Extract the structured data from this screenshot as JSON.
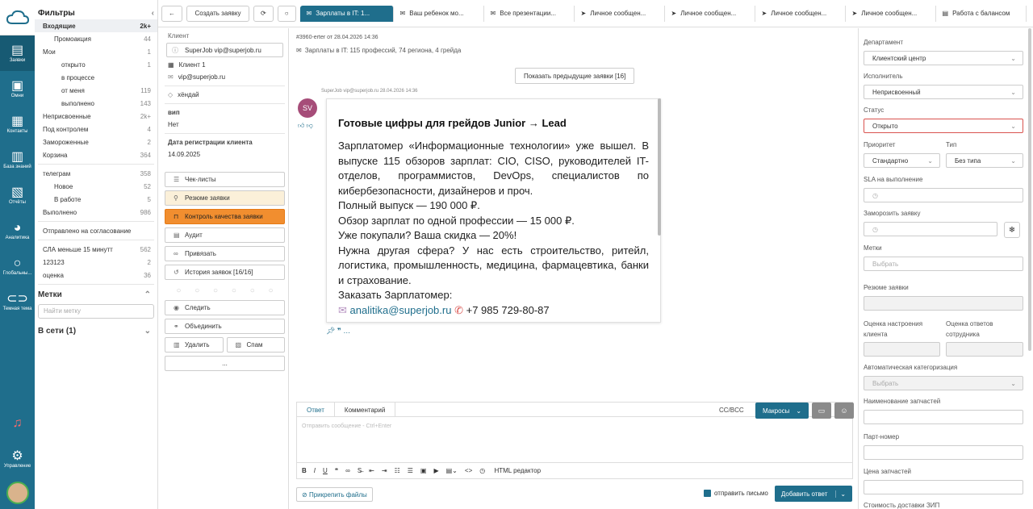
{
  "nav": {
    "items": [
      {
        "label": "Заявки",
        "icon": "tickets-icon"
      },
      {
        "label": "Омни",
        "icon": "omni-icon"
      },
      {
        "label": "Контакты",
        "icon": "contacts-icon"
      },
      {
        "label": "База знаний",
        "icon": "knowledge-icon"
      },
      {
        "label": "Отчёты",
        "icon": "reports-icon"
      },
      {
        "label": "Аналитика",
        "icon": "analytics-icon"
      },
      {
        "label": "Глобальны...",
        "icon": "search-icon"
      },
      {
        "label": "Темная тема",
        "icon": "toggle-icon"
      }
    ],
    "manage_label": "Управление"
  },
  "filters": {
    "title": "Фильтры",
    "rows": [
      {
        "label": "Входящие",
        "count": "2k+"
      },
      {
        "label": "Промоакция",
        "count": "44"
      },
      {
        "label": "Мои",
        "count": "1"
      },
      {
        "label": "открыто",
        "count": "1"
      },
      {
        "label": "в процессе",
        "count": ""
      },
      {
        "label": "от меня",
        "count": "119"
      },
      {
        "label": "выполнено",
        "count": "143"
      },
      {
        "label": "Неприсвоенные",
        "count": "2k+"
      },
      {
        "label": "Под контролем",
        "count": "4"
      },
      {
        "label": "Замороженные",
        "count": "2"
      },
      {
        "label": "Корзина",
        "count": "364"
      },
      {
        "label": "телеграм",
        "count": "358"
      },
      {
        "label": "Новое",
        "count": "52"
      },
      {
        "label": "В работе",
        "count": "5"
      },
      {
        "label": "Выполнено",
        "count": "986"
      },
      {
        "label": "Отправлено на согласование",
        "count": ""
      },
      {
        "label": "СЛА меньше 15 минутт",
        "count": "562"
      },
      {
        "label": "123123",
        "count": "2"
      },
      {
        "label": "оценка",
        "count": "36"
      }
    ],
    "metki_title": "Метки",
    "metki_search": "Найти метку",
    "online": "В сети (1)"
  },
  "topbar": {
    "create_label": "Создать заявку",
    "tabs": [
      "Зарплаты в IT: 1...",
      "Ваш ребенок мо...",
      "Все презентации...",
      "Личное сообщен...",
      "Личное сообщен...",
      "Личное сообщен...",
      "Личное сообщен...",
      "Работа с балансом"
    ]
  },
  "client": {
    "label": "Клиент",
    "email_box": "SuperJob vip@superjob.ru",
    "client_name": "Клиент 1",
    "email": "vip@superjob.ru",
    "tag": "хёндай",
    "vip_label": "вип",
    "vip_value": "Нет",
    "reg_label": "Дата регистрации клиента",
    "reg_value": "14.09.2025",
    "actions": [
      "Чек-листы",
      "Резюме заявки",
      "Контроль качества заявки",
      "Аудит",
      "Привязать",
      "История заявок [16/16]"
    ],
    "follow": "Следить",
    "merge": "Объединить",
    "delete": "Удалить",
    "spam": "Спам",
    "more": "..."
  },
  "ticket": {
    "meta": "#3960-erter от 28.04.2026 14:36",
    "subject": "Зарплаты в IT: 115 профессий, 74 региона, 4 грейда",
    "prev_btn": "Показать предыдущие заявки [16]",
    "msg_meta": "SuperJob vip@superjob.ru 28.04.2026 14:36",
    "avatar": "SV",
    "heading": "Готовые цифры для грейдов Junior → Lead",
    "p1": "Зарплатомер «Информационные технологии» уже вышел. В выпуске 115 обзоров зарплат: CIO, CISO, руководителей IT-отделов, программистов, DevOps, специалистов по кибербезопасности, дизайнеров и проч.",
    "p2": "Полный выпуск — 190 000 ₽.",
    "p3": "Обзор зарплат по одной профессии — 15 000 ₽.",
    "p4": "Уже покупали? Ваша скидка — 20%!",
    "p5": "Нужна другая сфера? У нас есть строительство, ритейл, логистика, промышленность, медицина, фармацевтика, банки и страхование.",
    "p6": "Заказать Зарплатомер:",
    "contact_email": "analitika@superjob.ru",
    "contact_phone": "+7 985 729-80-87"
  },
  "reply": {
    "tab_reply": "Ответ",
    "tab_comment": "Комментарий",
    "ccbcc": "CC/BCC",
    "macros": "Макросы",
    "placeholder": "Отправить сообщение - Ctrl+Enter",
    "html_editor": "HTML редактор",
    "attach": "Прикрепить файлы",
    "send_letter": "отправить письмо",
    "send_btn": "Добавить ответ"
  },
  "right": {
    "department_label": "Департамент",
    "department": "Клиентский центр",
    "executor_label": "Исполнитель",
    "executor": "Неприсвоенный",
    "status_label": "Статус",
    "status": "Открыто",
    "priority_label": "Приоритет",
    "priority": "Стандартно",
    "type_label": "Тип",
    "type": "Без типа",
    "sla_label": "SLA на выполнение",
    "freeze_label": "Заморозить заявку",
    "tags_label": "Метки",
    "tags_placeholder": "Выбрать",
    "summary_label": "Резюме заявки",
    "mood_label": "Оценка настроения клиента",
    "answers_label": "Оценка ответов сотрудника",
    "autocat_label": "Автоматическая категоризация",
    "autocat_placeholder": "Выбрать",
    "parts_label": "Наименование запчастей",
    "partno_label": "Парт-номер",
    "price_label": "Цена запчастей",
    "delivery_label": "Стоимость доставки ЗИП"
  }
}
